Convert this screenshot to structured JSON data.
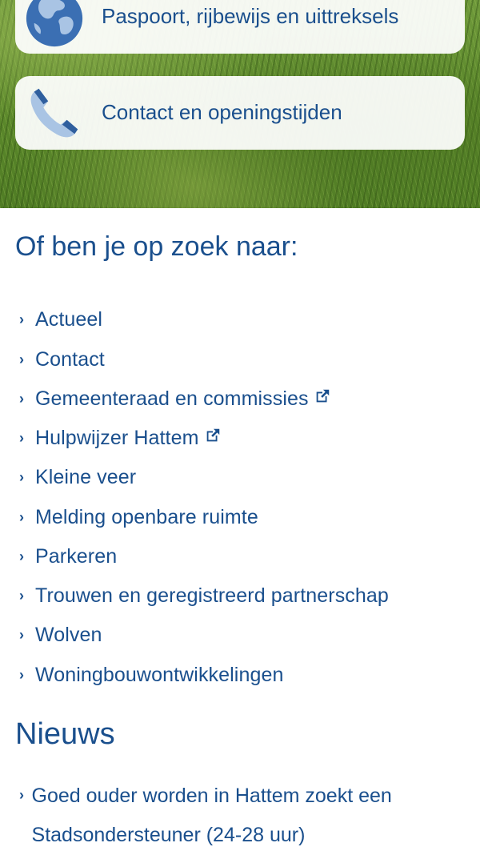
{
  "hero": {
    "cards": [
      {
        "label": "Paspoort, rijbewijs en uittreksels",
        "icon": "globe-icon"
      },
      {
        "label": "Contact en openingstijden",
        "icon": "phone-icon"
      }
    ]
  },
  "links_section": {
    "title": "Of ben je op zoek naar:",
    "items": [
      {
        "label": "Actueel",
        "external": false
      },
      {
        "label": "Contact",
        "external": false
      },
      {
        "label": "Gemeenteraad en commissies",
        "external": true
      },
      {
        "label": "Hulpwijzer Hattem",
        "external": true
      },
      {
        "label": "Kleine veer",
        "external": false
      },
      {
        "label": "Melding openbare ruimte",
        "external": false
      },
      {
        "label": "Parkeren",
        "external": false
      },
      {
        "label": "Trouwen en geregistreerd partnerschap",
        "external": false
      },
      {
        "label": "Wolven",
        "external": false
      },
      {
        "label": "Woningbouwontwikkelingen",
        "external": false
      }
    ]
  },
  "news_section": {
    "title": "Nieuws",
    "items": [
      {
        "label": "Goed ouder worden in Hattem zoekt een Stadsondersteuner (24-28 uur)"
      }
    ]
  },
  "colors": {
    "primary": "#1a4f8d",
    "card_background": "#ffffff",
    "icon_accent": "#3b6fb3"
  }
}
